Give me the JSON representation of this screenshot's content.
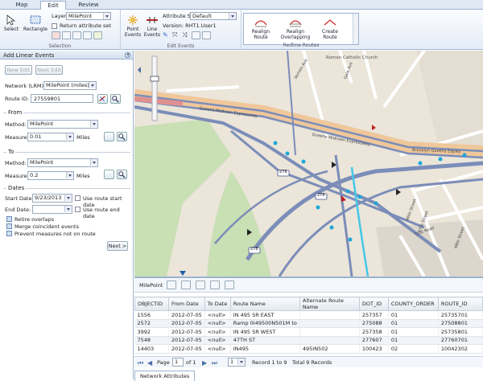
{
  "tabs": [
    "Map",
    "Edit",
    "Review"
  ],
  "ribbon": {
    "selection": {
      "select": "Select",
      "rectangle": "Rectangle",
      "layer_label": "Layer:",
      "layer_value": "MilePoint",
      "return_attr": "Return attribute set",
      "group": "Selection"
    },
    "edit_events": {
      "point_events": "Point Events",
      "line_events": "Line Events",
      "attr_set_label": "Attribute Set:",
      "attr_set_value": "Default",
      "version": "Version: RHT1.User1",
      "group": "Edit Events"
    },
    "redline": {
      "realign": "Realign Route",
      "realign_overlap": "Realign Overlapping",
      "create": "Create Route",
      "group": "Redline Routes"
    }
  },
  "panel": {
    "title": "Add Linear Events",
    "new_edit": "New Edit",
    "next_edit": "Next Edit",
    "network_label": "Network (LRM):",
    "network_value": "MilePoint (miles)",
    "route_label": "Route ID:",
    "route_value": "27559801",
    "from_title": "From",
    "from_method_label": "Method:",
    "from_method_value": "MilePoint",
    "from_measure_label": "Measure:",
    "from_measure_value": "0.01",
    "from_units": "Miles",
    "to_title": "To",
    "to_method_label": "Method:",
    "to_method_value": "MilePoint",
    "to_measure_label": "Measure:",
    "to_measure_value": "0.2",
    "to_units": "Miles",
    "dates_title": "Dates",
    "start_label": "Start Date:",
    "start_value": "9/23/2013",
    "use_start": "Use route start date",
    "end_label": "End Date:",
    "end_value": "",
    "use_end": "Use route end date",
    "retire": "Retire overlaps",
    "merge": "Merge coincident events",
    "prevent": "Prevent measures not on route",
    "next": "Next >"
  },
  "map": {
    "streets": [
      "Queens-Midtown Expressway",
      "Queens-Midtown Expressway",
      "Brooklyn Queens Expwy",
      "46th Street",
      "47th Street",
      "51st Road",
      "48th Street",
      "Vernon Ave",
      "Gale Ave",
      "Roman Catholic Church"
    ],
    "shields": [
      "278",
      "278",
      "278"
    ]
  },
  "grid": {
    "layer": "MilePoint",
    "columns": [
      "OBJECTID",
      "From Date",
      "To Date",
      "Route Name",
      "Alternate Route Name",
      "DOT_ID",
      "COUNTY_ORDER",
      "ROUTE_ID"
    ],
    "rows": [
      [
        "1556",
        "2012-07-05",
        "<null>",
        "IN 495 SR EAST",
        "",
        "257357",
        "01",
        "25735701"
      ],
      [
        "2572",
        "2012-07-05",
        "<null>",
        "Ramp 0I49500N501M to",
        "",
        "275088",
        "01",
        "27508801"
      ],
      [
        "3992",
        "2012-07-05",
        "<null>",
        "IN 495 SR WEST",
        "",
        "257358",
        "01",
        "25735801"
      ],
      [
        "7548",
        "2012-07-05",
        "<null>",
        "47TH ST",
        "",
        "277607",
        "01",
        "27760701"
      ],
      [
        "14403",
        "2012-07-05",
        "<null>",
        "IN495",
        "495IN502",
        "100423",
        "02",
        "10042302"
      ]
    ],
    "page_label": "Page",
    "page_value": "1",
    "page_of": "of 1",
    "page_size": "1",
    "record_range": "Record 1 to 9",
    "total": "Total 9 Records",
    "bottom_tab": "Network Attributes"
  }
}
